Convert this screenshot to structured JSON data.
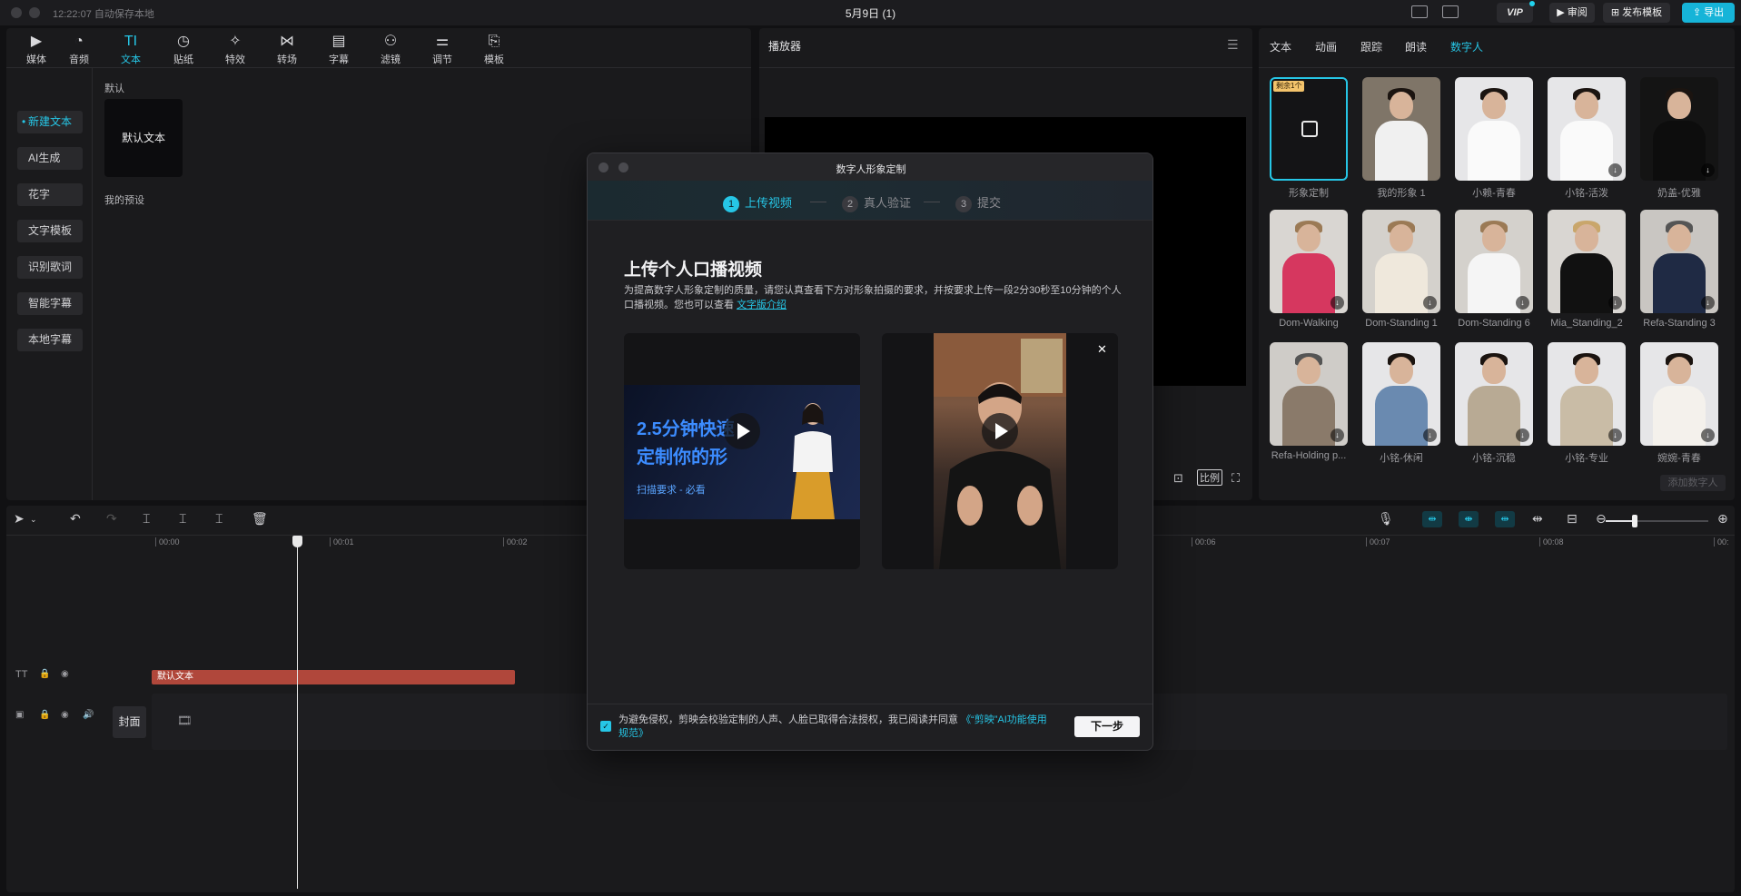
{
  "titlebar": {
    "autosave": "12:22:07 自动保存本地",
    "title": "5月9日 (1)",
    "vip": "VIP",
    "review": "审阅",
    "publish": "发布模板",
    "export": "导出"
  },
  "toolbar": {
    "items": [
      {
        "label": "媒体",
        "icon": "media-icon"
      },
      {
        "label": "音频",
        "icon": "audio-icon"
      },
      {
        "label": "文本",
        "icon": "text-icon"
      },
      {
        "label": "贴纸",
        "icon": "sticker-icon"
      },
      {
        "label": "特效",
        "icon": "effects-icon"
      },
      {
        "label": "转场",
        "icon": "transition-icon"
      },
      {
        "label": "字幕",
        "icon": "subtitle-icon"
      },
      {
        "label": "滤镜",
        "icon": "filter-icon"
      },
      {
        "label": "调节",
        "icon": "adjust-icon"
      },
      {
        "label": "模板",
        "icon": "template-icon"
      }
    ],
    "active": "文本"
  },
  "sidenav": {
    "items": [
      "新建文本",
      "AI生成",
      "花字",
      "文字模板",
      "识别歌词",
      "智能字幕",
      "本地字幕"
    ]
  },
  "text_panel": {
    "section_default": "默认",
    "default_card": "默认文本",
    "section_preset": "我的预设"
  },
  "player": {
    "title": "播放器",
    "ratio": "比例"
  },
  "right_panel": {
    "tabs": [
      "文本",
      "动画",
      "跟踪",
      "朗读",
      "数字人"
    ],
    "active_tab": "数字人",
    "custom_badge": "剩余1个",
    "avatars": [
      "形象定制",
      "我的形象 1",
      "小赖-青春",
      "小铭-活泼",
      "奶盖-优雅",
      "Dom-Walking",
      "Dom-Standing 1",
      "Dom-Standing 6",
      "Mia_Standing_2",
      "Refa-Standing 3",
      "Refa-Holding p...",
      "小铭-休闲",
      "小铭-沉稳",
      "小铭-专业",
      "婉婉-青春"
    ],
    "add_button": "添加数字人"
  },
  "timeline": {
    "ruler": [
      "00:00",
      "00:01",
      "00:02",
      "00:06",
      "00:07",
      "00:08",
      "00:"
    ],
    "text_clip": "默认文本",
    "cover": "封面"
  },
  "dialog": {
    "title": "数字人形象定制",
    "steps": [
      {
        "num": "1",
        "label": "上传视频"
      },
      {
        "num": "2",
        "label": "真人验证"
      },
      {
        "num": "3",
        "label": "提交"
      }
    ],
    "heading": "上传个人口播视频",
    "desc": "为提高数字人形象定制的质量，请您认真查看下方对形象拍摄的要求，并按要求上传一段2分30秒至10分钟的个人口播视频。您也可以查看 ",
    "desc_link": "文字版介绍",
    "promo_line1": "2.5分钟快速",
    "promo_line2": "定制你的形",
    "promo_sub": "扫描要求 - 必看",
    "agree_text": "为避免侵权，剪映会校验定制的人声、人脸已取得合法授权，我已阅读并同意 ",
    "agree_link": "《“剪映”AI功能使用规范》",
    "next": "下一步"
  }
}
